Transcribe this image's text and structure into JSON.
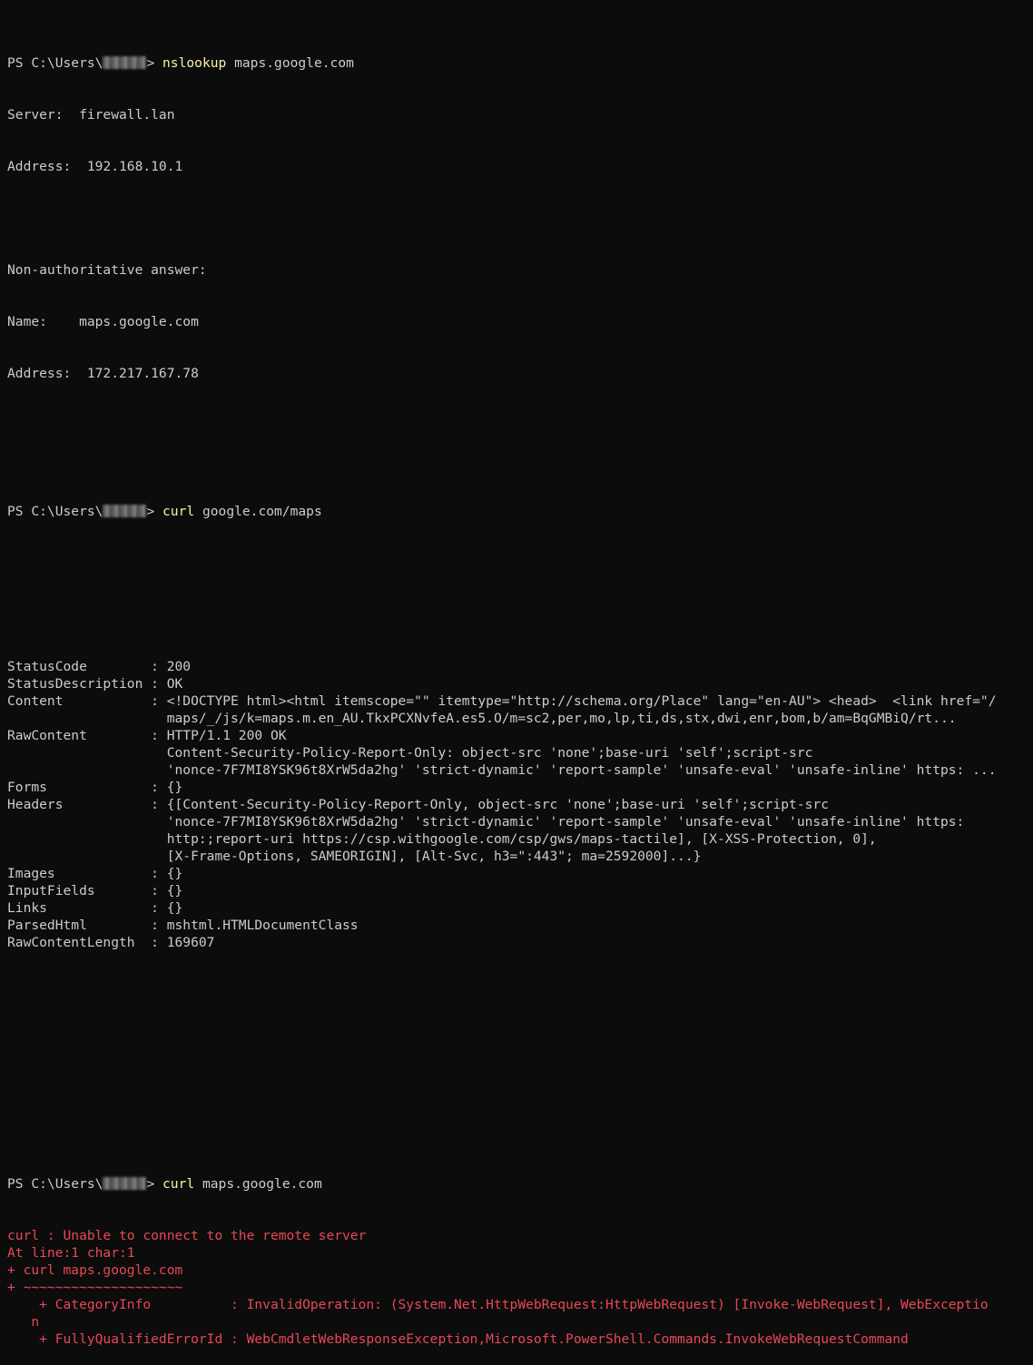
{
  "prompt": {
    "prefix": "PS C:\\Users\\",
    "suffix": "> "
  },
  "block1": {
    "command": "nslookup",
    "args": " maps.google.com",
    "server_line": "Server:  firewall.lan",
    "address_line": "Address:  192.168.10.1",
    "nonauth": "Non-authoritative answer:",
    "name_line": "Name:    maps.google.com",
    "addr2_line": "Address:  172.217.167.78"
  },
  "block2": {
    "command": "curl",
    "args": " google.com/maps",
    "lines": [
      "StatusCode        : 200",
      "StatusDescription : OK",
      "Content           : <!DOCTYPE html><html itemscope=\"\" itemtype=\"http://schema.org/Place\" lang=\"en-AU\"> <head>  <link href=\"/",
      "                    maps/_/js/k=maps.m.en_AU.TkxPCXNvfeA.es5.O/m=sc2,per,mo,lp,ti,ds,stx,dwi,enr,bom,b/am=BqGMBiQ/rt...",
      "RawContent        : HTTP/1.1 200 OK",
      "                    Content-Security-Policy-Report-Only: object-src 'none';base-uri 'self';script-src",
      "                    'nonce-7F7MI8YSK96t8XrW5da2hg' 'strict-dynamic' 'report-sample' 'unsafe-eval' 'unsafe-inline' https: ...",
      "Forms             : {}",
      "Headers           : {[Content-Security-Policy-Report-Only, object-src 'none';base-uri 'self';script-src",
      "                    'nonce-7F7MI8YSK96t8XrW5da2hg' 'strict-dynamic' 'report-sample' 'unsafe-eval' 'unsafe-inline' https:",
      "                    http:;report-uri https://csp.withgoogle.com/csp/gws/maps-tactile], [X-XSS-Protection, 0],",
      "                    [X-Frame-Options, SAMEORIGIN], [Alt-Svc, h3=\":443\"; ma=2592000]...}",
      "Images            : {}",
      "InputFields       : {}",
      "Links             : {}",
      "ParsedHtml        : mshtml.HTMLDocumentClass",
      "RawContentLength  : 169607"
    ]
  },
  "block3": {
    "command": "curl",
    "args": " maps.google.com",
    "errors": [
      "curl : Unable to connect to the remote server",
      "At line:1 char:1",
      "+ curl maps.google.com",
      "+ ~~~~~~~~~~~~~~~~~~~~",
      "    + CategoryInfo          : InvalidOperation: (System.Net.HttpWebRequest:HttpWebRequest) [Invoke-WebRequest], WebExceptio",
      "   n",
      "    + FullyQualifiedErrorId : WebCmdletWebResponseException,Microsoft.PowerShell.Commands.InvokeWebRequestCommand"
    ]
  },
  "colors": {
    "background": "#0c0c0c",
    "text": "#cccccc",
    "command": "#f9f1a5",
    "error": "#e74856"
  }
}
